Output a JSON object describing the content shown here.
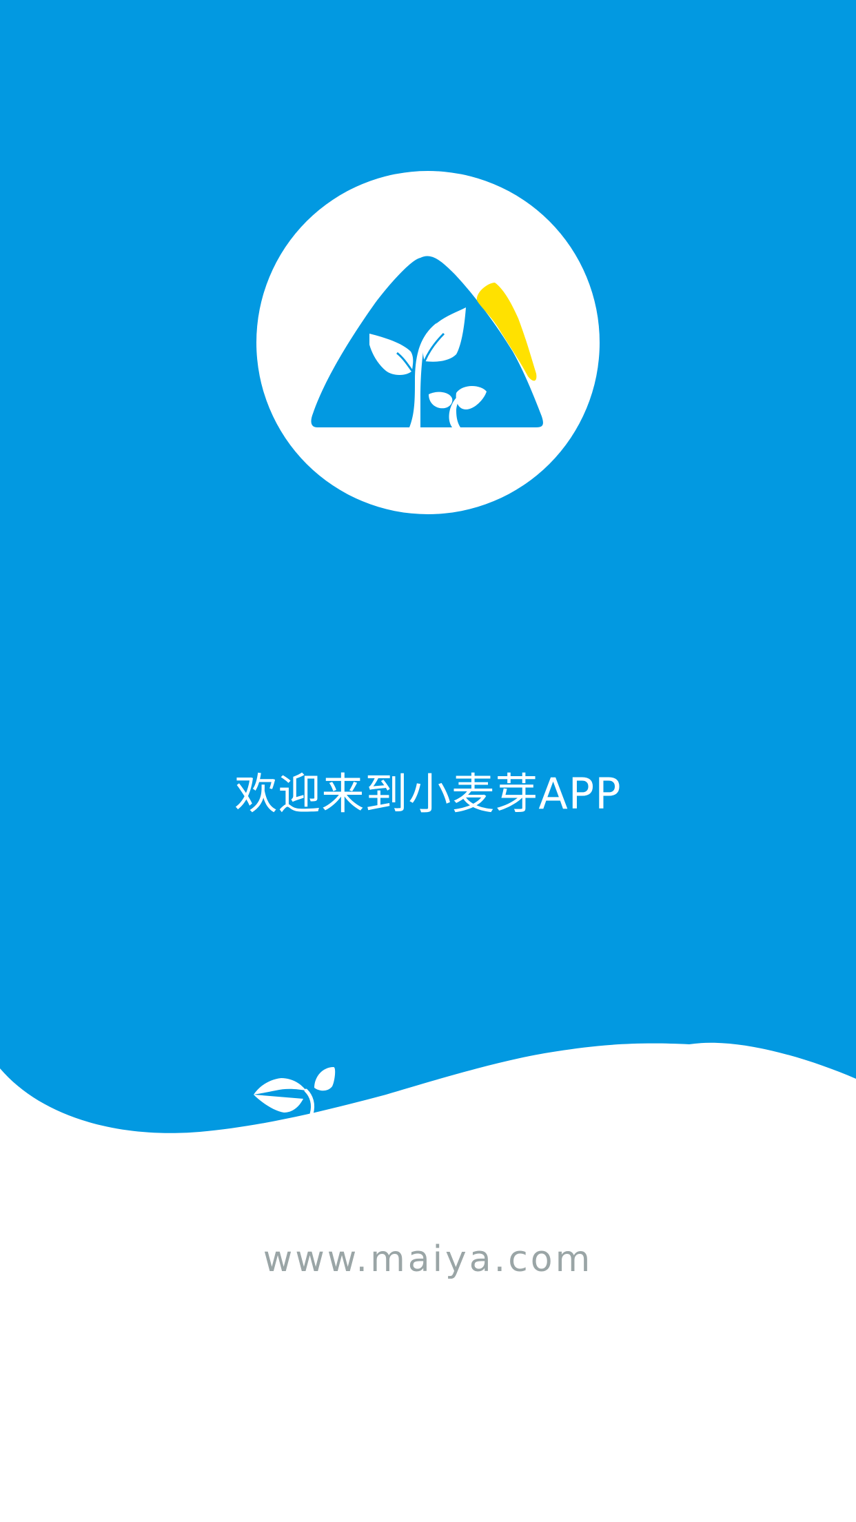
{
  "welcome_text": "欢迎来到小麦芽APP",
  "website_text": "www.maiya.com",
  "icons": {
    "app_logo": "mountain-sprout-logo-icon",
    "wave_sprout": "sprout-icon"
  },
  "colors": {
    "brand_blue": "#0299e1",
    "sun_yellow": "#ffe100",
    "website_gray": "#9aa5a6",
    "white": "#ffffff"
  }
}
